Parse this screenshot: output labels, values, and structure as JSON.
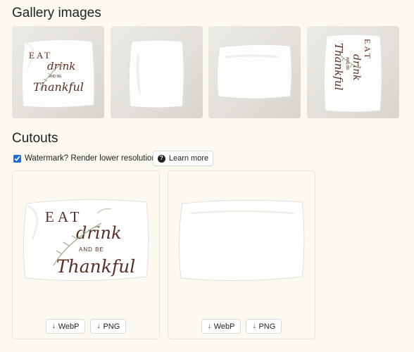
{
  "gallery": {
    "title": "Gallery images",
    "images": [
      {
        "name": "Eat drink and be Thankful pillow front",
        "has_print": true
      },
      {
        "name": "Plain pillow back",
        "has_print": false
      },
      {
        "name": "Plain pillow side",
        "has_print": false
      },
      {
        "name": "Eat drink and be Thankful pillow rotated",
        "has_print": true
      }
    ]
  },
  "print_text": {
    "line1": "EAT",
    "line2": "drink",
    "line3": "AND BE",
    "line4": "Thankful"
  },
  "cutouts": {
    "title": "Cutouts",
    "watermark_label": "Watermark? Render lower resolution.",
    "watermark_checked": true,
    "learn_more_label": "Learn more",
    "cards": [
      {
        "webp_label": "WebP",
        "png_label": "PNG"
      },
      {
        "webp_label": "WebP",
        "png_label": "PNG"
      }
    ]
  },
  "colors": {
    "background": "#fcf9f1",
    "print_brown": "#5b2d27",
    "leaf_green": "#9aa88a"
  }
}
